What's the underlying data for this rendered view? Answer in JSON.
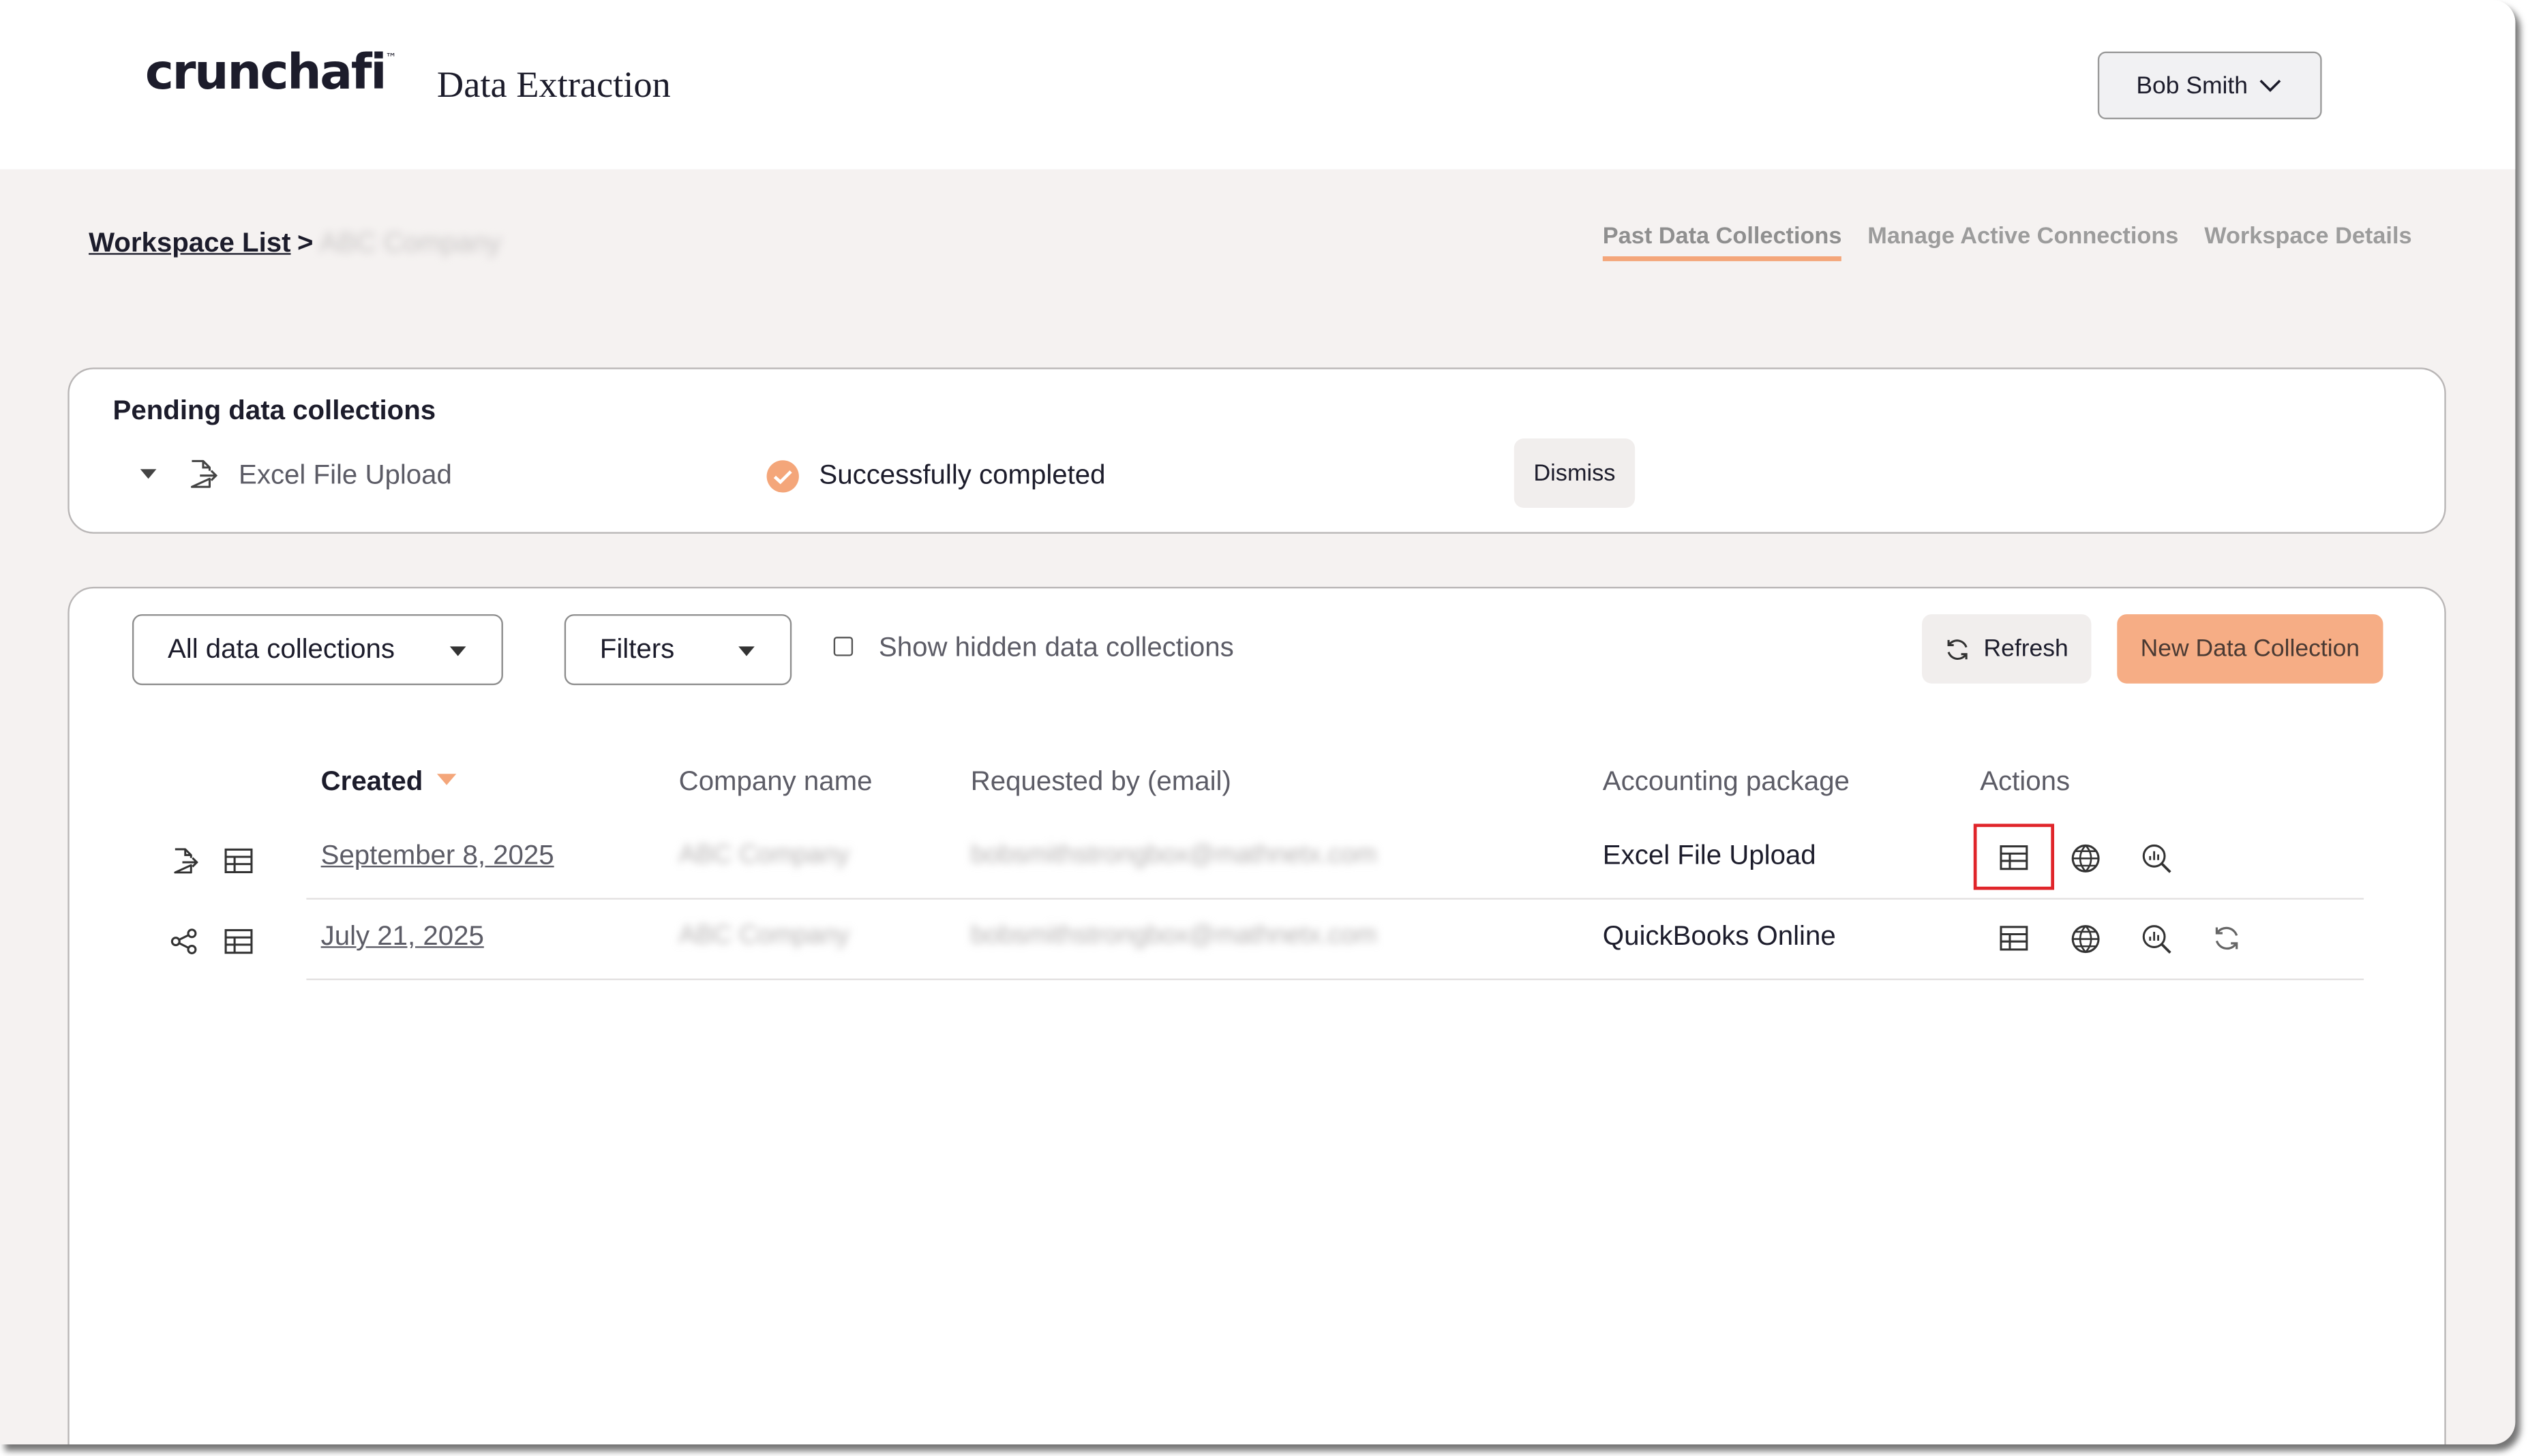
{
  "header": {
    "logo_text": "crunchafi",
    "logo_tm": "™",
    "app_title": "Data Extraction",
    "user_name": "Bob Smith"
  },
  "breadcrumb": {
    "root_label": "Workspace List",
    "separator": ">",
    "current": "ABC Company"
  },
  "tabs": [
    {
      "label": "Past Data Collections",
      "active": true
    },
    {
      "label": "Manage Active Connections",
      "active": false
    },
    {
      "label": "Workspace Details",
      "active": false
    }
  ],
  "pending": {
    "title": "Pending data collections",
    "item_label": "Excel File Upload",
    "status": "Successfully completed",
    "dismiss_label": "Dismiss"
  },
  "toolbar": {
    "collections_dropdown": "All data collections",
    "filters_dropdown": "Filters",
    "show_hidden_label": "Show hidden data collections",
    "refresh_label": "Refresh",
    "new_label": "New Data Collection"
  },
  "table": {
    "columns": [
      "Created",
      "Company name",
      "Requested by (email)",
      "Accounting package",
      "Actions"
    ],
    "rows": [
      {
        "created": "September 8, 2025",
        "company": "ABC Company",
        "requested_by": "bobsmithstrongbox@mathnetx.com",
        "package": "Excel File Upload",
        "source_icon": "file-export-icon",
        "actions": [
          "table-icon",
          "globe-icon",
          "analyze-icon"
        ]
      },
      {
        "created": "July 21, 2025",
        "company": "ABC Company",
        "requested_by": "bobsmithstrongbox@mathnetx.com",
        "package": "QuickBooks Online",
        "source_icon": "share-icon",
        "actions": [
          "table-icon",
          "globe-icon",
          "analyze-icon",
          "refresh-icon"
        ]
      }
    ]
  },
  "colors": {
    "accent": "#f6ad85",
    "active_tab_underline": "#f4a67a",
    "success": "#f4a67a",
    "highlight": "#e0252a"
  }
}
